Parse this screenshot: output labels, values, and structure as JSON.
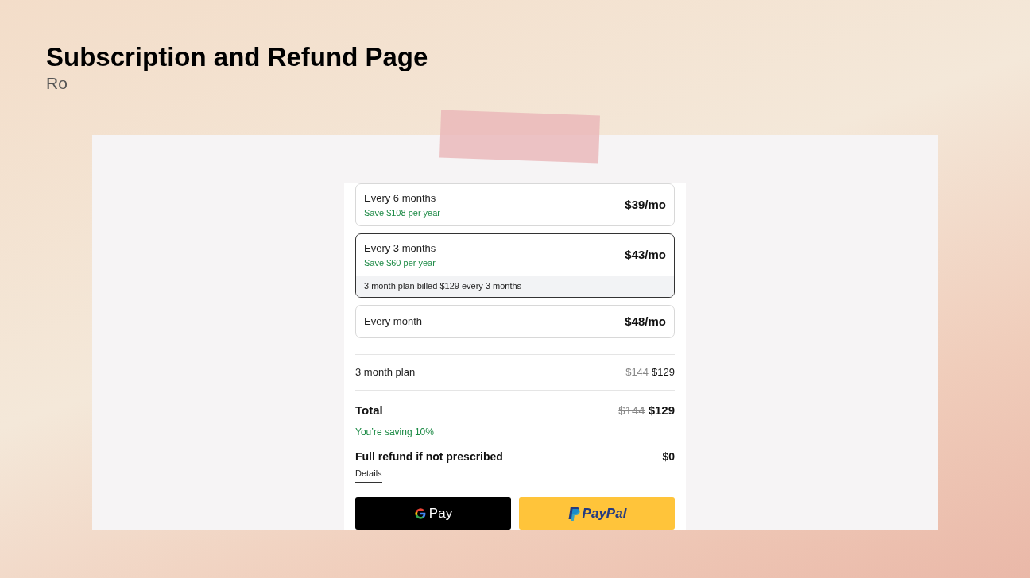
{
  "slide": {
    "title": "Subscription and Refund Page",
    "subtitle": "Ro"
  },
  "plans": [
    {
      "name": "Every 6 months",
      "saving": "Save $108 per year",
      "price": "$39/mo",
      "selected": false
    },
    {
      "name": "Every 3 months",
      "saving": "Save $60 per year",
      "price": "$43/mo",
      "selected": true,
      "billing_note": "3 month plan billed $129 every 3 months"
    },
    {
      "name": "Every month",
      "price": "$48/mo",
      "selected": false
    }
  ],
  "summary": {
    "line": {
      "label": "3 month plan",
      "old_price": "$144",
      "price": "$129"
    },
    "total": {
      "label": "Total",
      "old_price": "$144",
      "price": "$129",
      "saving": "You’re saving 10%"
    },
    "refund": {
      "label": "Full refund if not prescribed",
      "price": "$0",
      "link": "Details"
    }
  },
  "pay_buttons": [
    {
      "kind": "gpay",
      "label": "Pay"
    },
    {
      "kind": "paypal",
      "label": "PayPal"
    }
  ]
}
